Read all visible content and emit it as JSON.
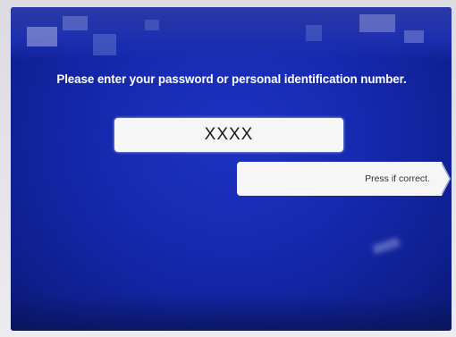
{
  "screen": {
    "prompt": "Please enter your password or personal identification number.",
    "pin_field": {
      "value": "XXXX"
    },
    "confirm_button": {
      "label": "Press if correct."
    },
    "icons": {
      "confirm_arrow": "chevron-right-icon"
    },
    "colors": {
      "background": "#1528ae",
      "field": "#f6f6f6",
      "text": "#ffffff"
    }
  }
}
